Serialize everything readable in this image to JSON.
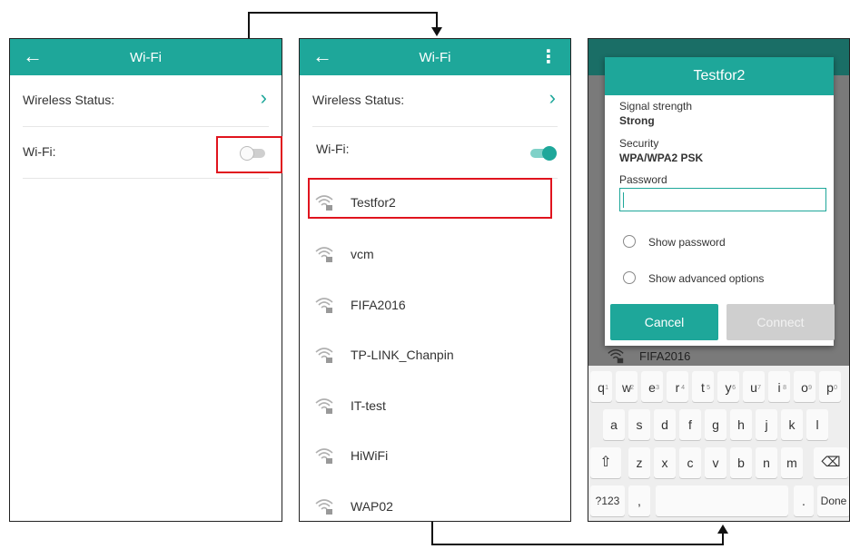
{
  "screen1": {
    "title": "Wi-Fi",
    "back_icon": "arrow-left-icon",
    "rows": [
      {
        "label": "Wireless Status:"
      },
      {
        "label": "Wi-Fi:"
      }
    ],
    "wifi_toggle": "off"
  },
  "screen2": {
    "title": "Wi-Fi",
    "back_icon": "arrow-left-icon",
    "more_icon": "more-vert-icon",
    "rows": [
      {
        "label": "Wireless Status:"
      },
      {
        "label": "Wi-Fi:"
      }
    ],
    "wifi_toggle": "on",
    "networks": [
      "Testfor2",
      "vcm",
      "FIFA2016",
      "TP-LINK_Chanpin",
      "IT-test",
      "HiWiFi",
      "WAP02"
    ]
  },
  "screen3": {
    "dialog": {
      "title": "Testfor2",
      "signal_label": "Signal strength",
      "signal_value": "Strong",
      "security_label": "Security",
      "security_value": "WPA/WPA2 PSK",
      "password_label": "Password",
      "password_value": "",
      "show_password": "Show password",
      "show_advanced": "Show advanced options",
      "cancel": "Cancel",
      "connect": "Connect"
    },
    "background_network": "FIFA2016",
    "keyboard": {
      "row1": [
        "q",
        "w",
        "e",
        "r",
        "t",
        "y",
        "u",
        "i",
        "o",
        "p"
      ],
      "row1_hints": [
        "1",
        "2",
        "3",
        "4",
        "5",
        "6",
        "7",
        "8",
        "9",
        "0"
      ],
      "row2": [
        "a",
        "s",
        "d",
        "f",
        "g",
        "h",
        "j",
        "k",
        "l"
      ],
      "row3": [
        "z",
        "x",
        "c",
        "v",
        "b",
        "n",
        "m"
      ],
      "shift_icon": "shift-icon",
      "backspace_icon": "backspace-icon",
      "sym": "?123",
      "comma": ",",
      "period": ".",
      "done": "Done"
    }
  },
  "colors": {
    "accent": "#1ea79a",
    "highlight": "#e0141e"
  }
}
